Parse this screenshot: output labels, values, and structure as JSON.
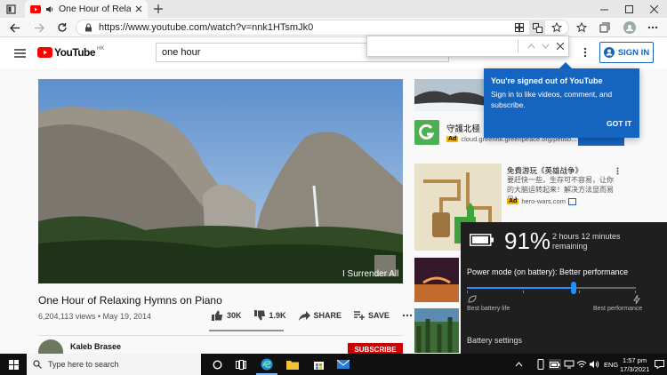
{
  "browser": {
    "tab_title": "One Hour of Relaxing Hymns",
    "url": "https://www.youtube.com/watch?v=nnk1HTsmJk0"
  },
  "youtube": {
    "logo_text": "YouTube",
    "logo_region": "HK",
    "search_value": "one hour",
    "signin_label": "SIGN IN"
  },
  "video": {
    "overlay_text": "I Surrender All",
    "title": "One Hour of Relaxing Hymns on Piano",
    "views_date": "6,204,113 views • May 19, 2014",
    "likes": "30K",
    "dislikes": "1.9K",
    "share": "SHARE",
    "save": "SAVE",
    "channel_name": "Kaleb Brasee",
    "subscribe": "SUBSCRIBE"
  },
  "popup": {
    "title": "You're signed out of YouTube",
    "body": "Sign in to like videos, comment, and subscribe.",
    "action": "GOT IT"
  },
  "ads": [
    {
      "title": "守護北極",
      "badge": "Ad",
      "url": "cloud.greenhk.greenpeace.org/petitio..."
    },
    {
      "title": "免費游玩《英雄战争》",
      "desc": "要赶快一些，生存可不容易，让你的大脑运转起来！解决方法显而易见！",
      "badge": "Ad",
      "url": "hero-wars.com"
    }
  ],
  "battery": {
    "percent": "91%",
    "remaining": "2 hours 12 minutes remaining",
    "mode": "Power mode (on battery): Better performance",
    "mode_value": 0.63,
    "left_label": "Best battery life",
    "right_label": "Best performance",
    "settings": "Battery settings"
  },
  "taskbar": {
    "search_placeholder": "Type here to search",
    "lang": "ENG",
    "time": "1:57 pm",
    "date": "17/3/2021"
  },
  "colors": {
    "youtube_red": "#ff0000",
    "signin_blue": "#1565c0",
    "battery_accent": "#1e90ff"
  }
}
